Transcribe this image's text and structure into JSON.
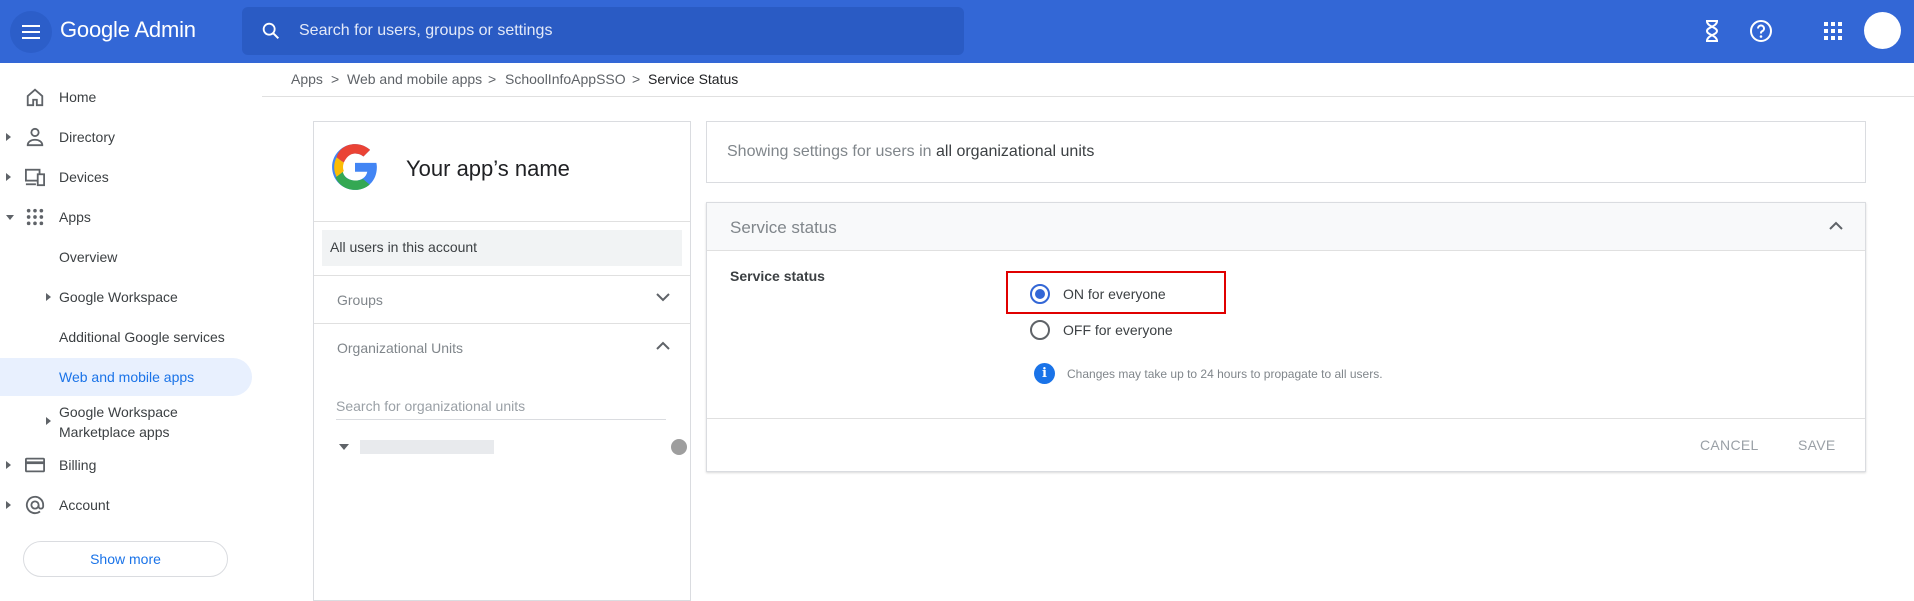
{
  "header": {
    "app_title": "Google Admin",
    "search_placeholder": "Search for users, groups or settings"
  },
  "sidebar": {
    "items": [
      {
        "label": "Home"
      },
      {
        "label": "Directory"
      },
      {
        "label": "Devices"
      },
      {
        "label": "Apps"
      },
      {
        "label": "Overview"
      },
      {
        "label": "Google Workspace"
      },
      {
        "label": "Additional Google services"
      },
      {
        "label": "Web and mobile apps"
      },
      {
        "label": "Google Workspace"
      },
      {
        "label": "Marketplace apps"
      },
      {
        "label": "Billing"
      },
      {
        "label": "Account"
      }
    ],
    "show_more": "Show more"
  },
  "breadcrumb": {
    "items": [
      "Apps",
      "Web and mobile apps",
      "SchoolInfoAppSSO",
      "Service Status"
    ],
    "separator": ">"
  },
  "left_panel": {
    "app_name": "Your app’s name",
    "all_users": "All users in this account",
    "groups_label": "Groups",
    "org_units_label": "Organizational Units",
    "org_search_placeholder": "Search for organizational units"
  },
  "banner": {
    "prefix": "Showing settings for users in ",
    "scope": "all organizational units"
  },
  "service_card": {
    "title": "Service status",
    "field_label": "Service status",
    "options": [
      "ON for everyone",
      "OFF for everyone"
    ],
    "selected": "ON for everyone",
    "info_text": "Changes may take up to 24 hours to propagate to all users.",
    "cancel_label": "CANCEL",
    "save_label": "SAVE"
  },
  "colors": {
    "topbar": "#3367d6",
    "accent": "#1a73e8",
    "highlight_box": "#e00000"
  }
}
